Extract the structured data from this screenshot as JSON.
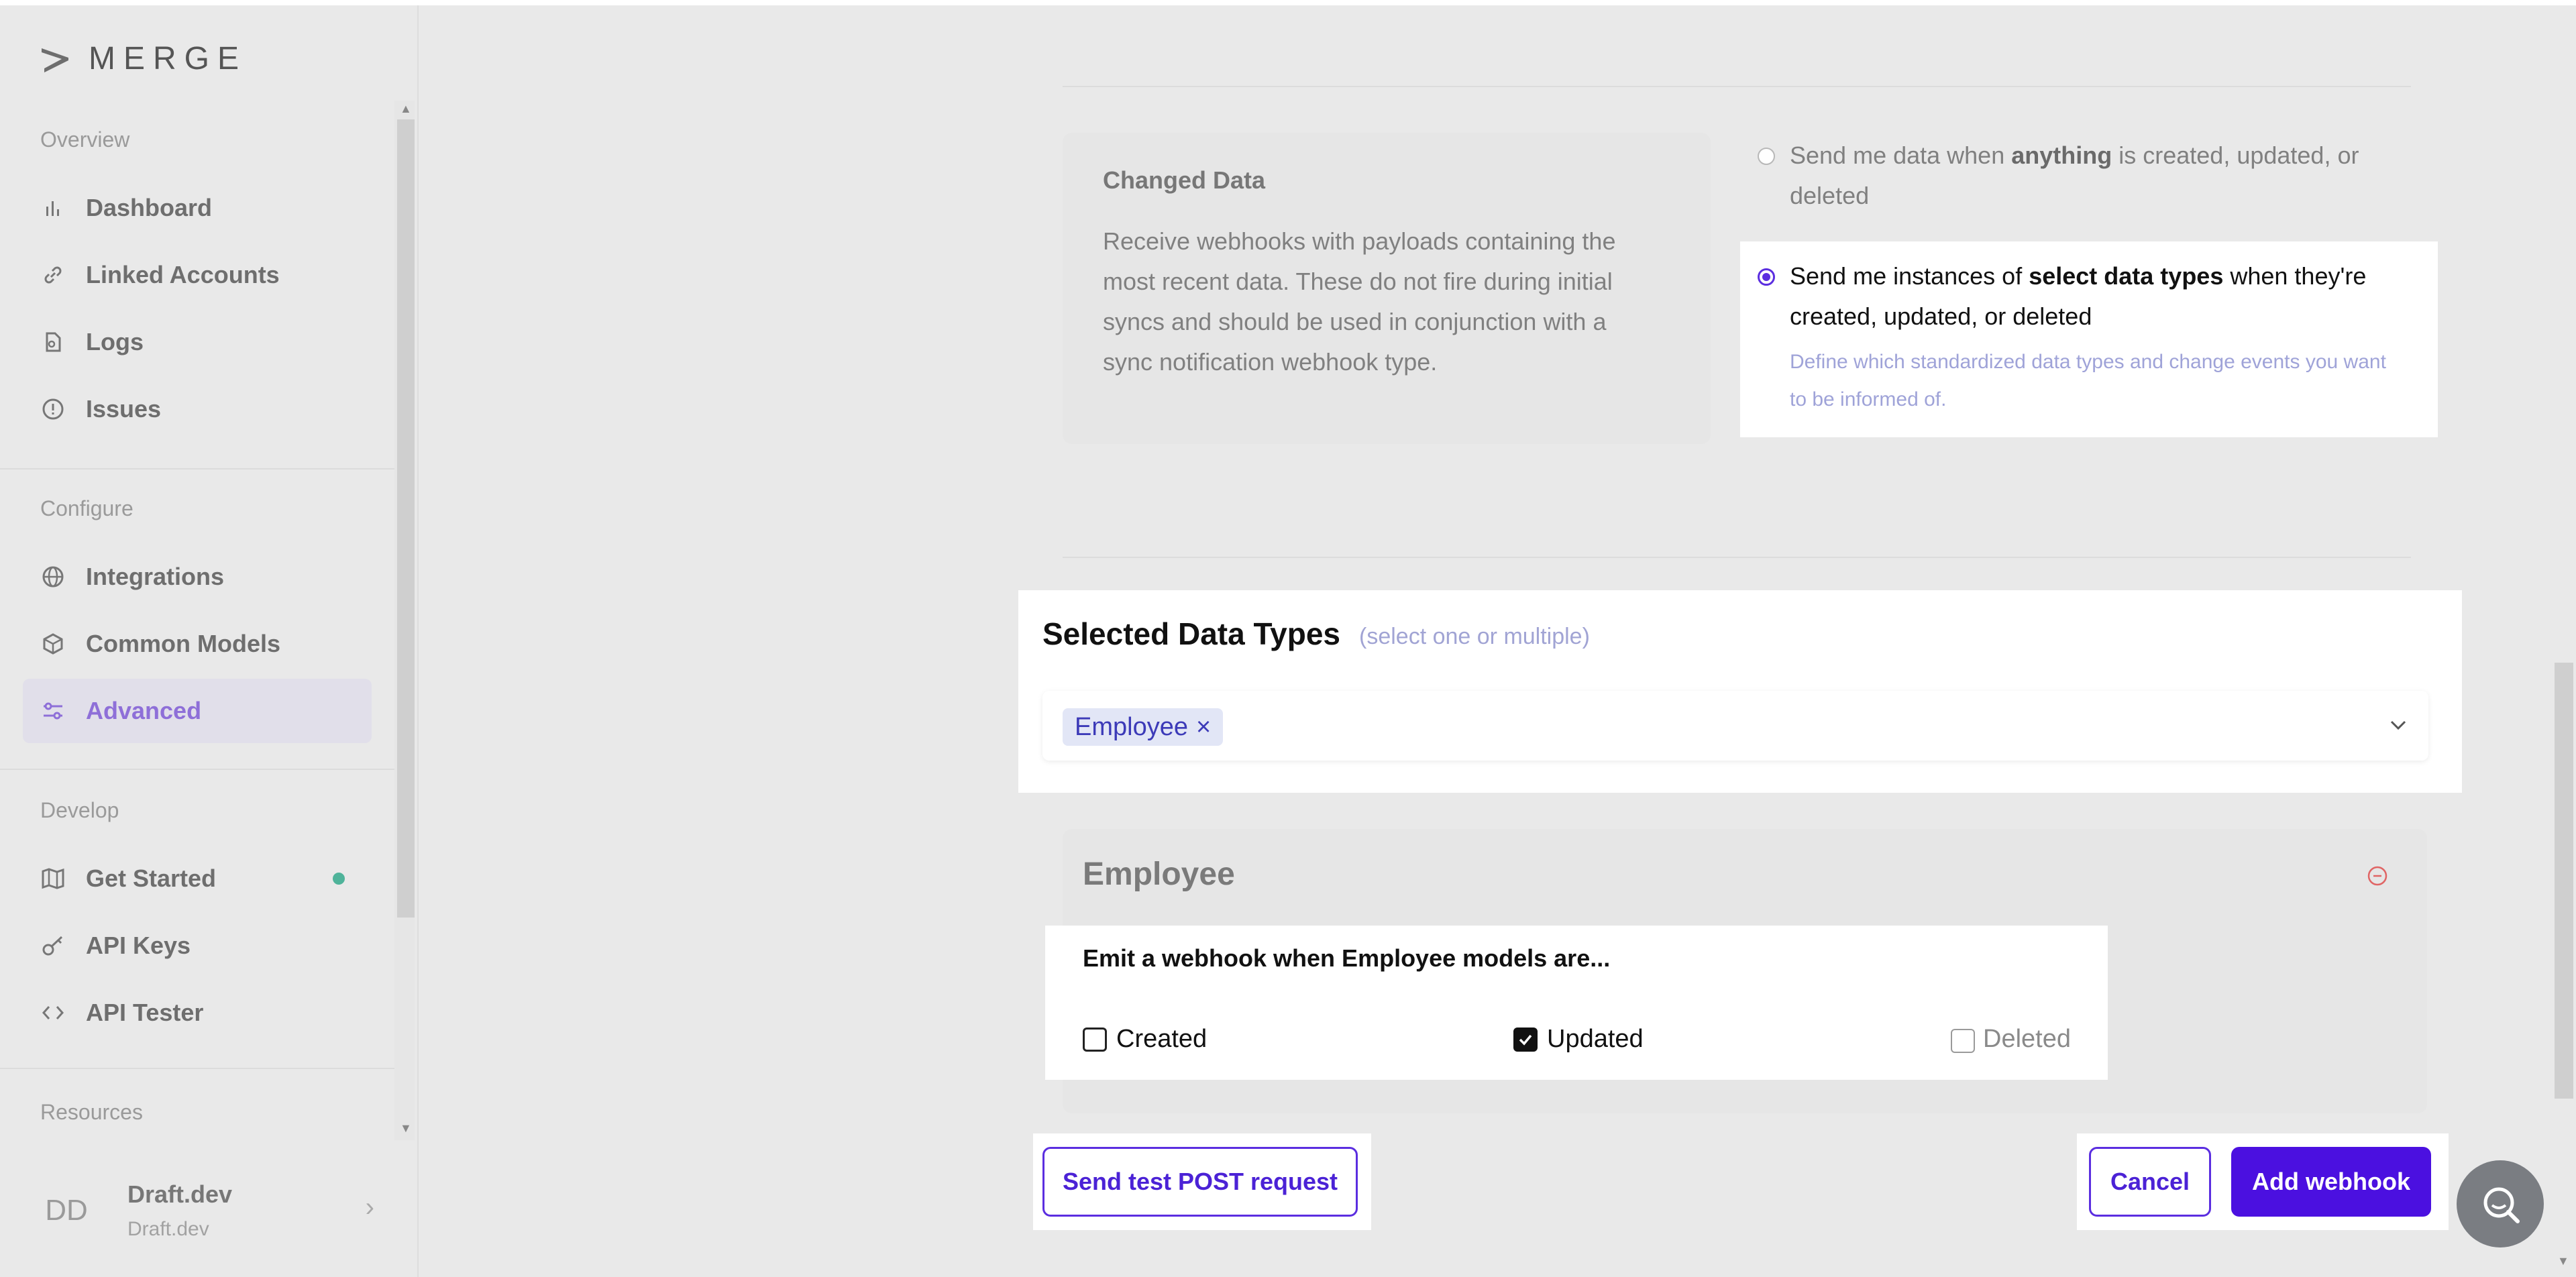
{
  "sidebar": {
    "brand": "MERGE",
    "sections": {
      "overview": "Overview",
      "configure": "Configure",
      "develop": "Develop",
      "resources": "Resources"
    },
    "items": {
      "dashboard": "Dashboard",
      "linked_accounts": "Linked Accounts",
      "logs": "Logs",
      "issues": "Issues",
      "integrations": "Integrations",
      "common_models": "Common Models",
      "advanced": "Advanced",
      "get_started": "Get Started",
      "api_keys": "API Keys",
      "api_tester": "API Tester"
    },
    "active_item": "advanced",
    "org": {
      "initials": "DD",
      "name": "Draft.dev",
      "sub": "Draft.dev"
    }
  },
  "changed_data": {
    "title": "Changed Data",
    "description": "Receive webhooks with payloads containing the most recent data. These do not fire during initial syncs and should be used in conjunction with a sync notification webhook type.",
    "option_anything": {
      "prefix": "Send me data when ",
      "bold": "anything",
      "suffix": " is created, updated, or deleted",
      "selected": false
    },
    "option_select": {
      "prefix": "Send me instances of ",
      "bold": "select data types",
      "suffix": " when they're created, updated, or deleted",
      "hint": "Define which standardized data types and change events you want to be informed of.",
      "selected": true
    }
  },
  "selected_data_types": {
    "title": "Selected Data Types",
    "hint": "(select one or multiple)",
    "chips": [
      "Employee"
    ],
    "remove_glyph": "×"
  },
  "employee": {
    "title": "Employee",
    "emit_title": "Emit a webhook when Employee models are...",
    "events": {
      "created": {
        "label": "Created",
        "checked": false
      },
      "updated": {
        "label": "Updated",
        "checked": true
      },
      "deleted": {
        "label": "Deleted",
        "checked": false
      }
    }
  },
  "actions": {
    "send_test": "Send test POST request",
    "cancel": "Cancel",
    "add_webhook": "Add webhook"
  },
  "colors": {
    "accent": "#4b10e0",
    "active_nav": "#8e6fd8",
    "status_dot": "#4fb39a",
    "remove_icon": "#e06565"
  }
}
